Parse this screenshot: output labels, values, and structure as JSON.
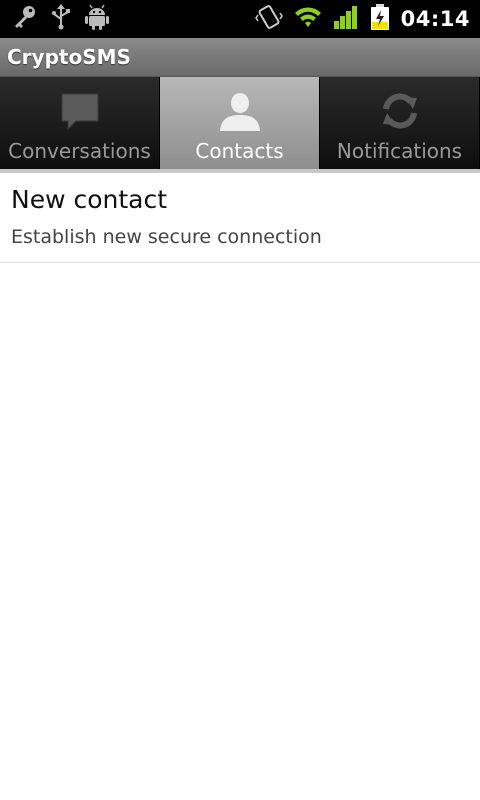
{
  "status_bar": {
    "time": "04:14",
    "left_icons": [
      "key-icon",
      "usb-icon",
      "android-debug-icon"
    ],
    "right_icons": [
      "vibrate-icon",
      "wifi-icon",
      "signal-icon",
      "battery-charging-icon"
    ]
  },
  "app": {
    "title": "CryptoSMS"
  },
  "tabs": [
    {
      "label": "Conversations",
      "icon": "chat-bubble-icon",
      "selected": false
    },
    {
      "label": "Contacts",
      "icon": "person-icon",
      "selected": true
    },
    {
      "label": "Notifications",
      "icon": "refresh-icon",
      "selected": false
    }
  ],
  "list": {
    "items": [
      {
        "title": "New contact",
        "subtitle": "Establish new secure connection"
      }
    ]
  },
  "colors": {
    "accent_signal": "#8ccf1e",
    "battery_charge": "#f4e000"
  }
}
